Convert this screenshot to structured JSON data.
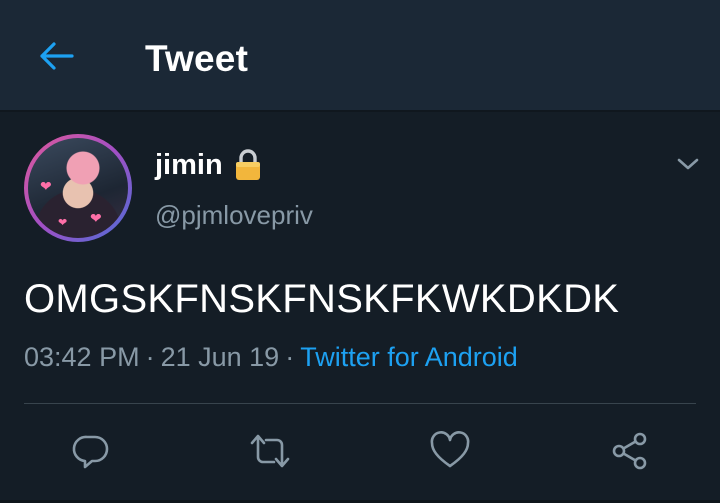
{
  "colors": {
    "background": "#141d26",
    "header_bg": "#1b2836",
    "accent": "#1da1f2",
    "secondary_text": "#8899a6"
  },
  "header": {
    "title": "Tweet",
    "back_icon": "arrow-left-icon"
  },
  "tweet": {
    "author": {
      "display_name": "jimin",
      "handle": "@pjmlovepriv",
      "protected_icon": "lock-icon"
    },
    "text": "OMGSKFNSKFNSKFKWKDKDK",
    "time": "03:42 PM",
    "date": "21 Jun 19",
    "separator": "·",
    "client": "Twitter for Android",
    "menu_icon": "chevron-down-icon"
  },
  "actions": [
    {
      "name": "reply",
      "icon": "reply-icon"
    },
    {
      "name": "retweet",
      "icon": "retweet-icon"
    },
    {
      "name": "like",
      "icon": "heart-icon"
    },
    {
      "name": "share",
      "icon": "share-icon"
    }
  ]
}
